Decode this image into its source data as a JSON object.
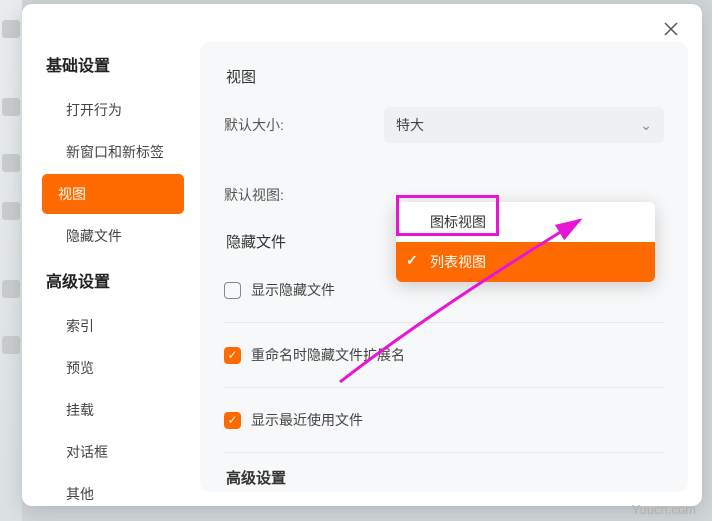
{
  "sidebar": {
    "basic_header": "基础设置",
    "basic_items": [
      "打开行为",
      "新窗口和新标签",
      "视图",
      "隐藏文件"
    ],
    "basic_active_index": 2,
    "advanced_header": "高级设置",
    "advanced_items": [
      "索引",
      "预览",
      "挂载",
      "对话框",
      "其他"
    ]
  },
  "content": {
    "view_title": "视图",
    "default_size_label": "默认大小:",
    "default_size_value": "特大",
    "default_view_label": "默认视图:",
    "hidden_title": "隐藏文件",
    "show_hidden": {
      "label": "显示隐藏文件",
      "checked": false
    },
    "hide_ext": {
      "label": "重命名时隐藏文件扩展名",
      "checked": true
    },
    "show_recent": {
      "label": "显示最近使用文件",
      "checked": true
    },
    "advanced_title": "高级设置"
  },
  "dropdown": {
    "options": [
      "图标视图",
      "列表视图"
    ],
    "selected_index": 1
  },
  "watermark": "Yuucn.com"
}
